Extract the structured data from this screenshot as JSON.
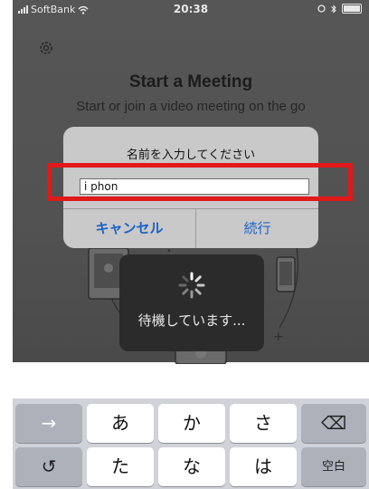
{
  "status_bar": {
    "carrier": "SoftBank",
    "time": "20:38"
  },
  "background": {
    "title": "Start a Meeting",
    "subtitle": "Start or join a video meeting on the go"
  },
  "dialog": {
    "title": "名前を入力してください",
    "input_value": "i phon",
    "cancel_label": "キャンセル",
    "continue_label": "続行"
  },
  "loading": {
    "text": "待機しています..."
  },
  "keyboard": {
    "row1": {
      "left": "→",
      "keys": [
        "あ",
        "か",
        "さ"
      ],
      "right": "⌫"
    },
    "row2": {
      "left": "↺",
      "keys": [
        "た",
        "な",
        "は"
      ],
      "right": "空白"
    }
  },
  "colors": {
    "accent": "#1a62c9",
    "highlight": "#e11919",
    "dim_overlay": "#555555",
    "keyboard_bg": "#cfd2d8"
  }
}
